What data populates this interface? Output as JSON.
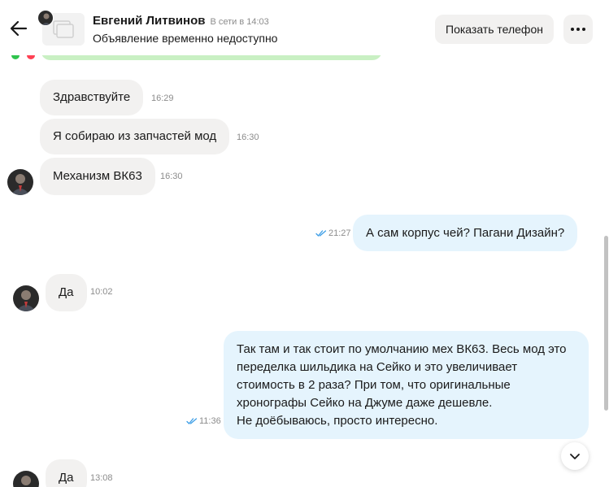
{
  "header": {
    "contact_name": "Евгений Литвинов",
    "presence": "В сети в 14:03",
    "listing_status": "Объявление временно недоступно",
    "show_phone_label": "Показать телефон"
  },
  "messages": [
    {
      "dir": "in",
      "text": "Здравствуйте",
      "time": "16:29"
    },
    {
      "dir": "in",
      "text": "Я собираю из запчастей мод",
      "time": "16:30"
    },
    {
      "dir": "in",
      "text": "Механизм ВК63",
      "time": "16:30"
    },
    {
      "dir": "out",
      "text": "А сам корпус чей? Пагани Дизайн?",
      "time": "21:27"
    },
    {
      "dir": "in",
      "text": "Да",
      "time": "10:02"
    },
    {
      "dir": "out",
      "lines": [
        "Так там и так стоит по умолчанию мех ВК63. Весь мод это",
        "переделка шильдика на Сейко и это увеличивает",
        "стоимость в 2 раза? При том, что оригинальные",
        "хронографы Сейко на Джуме даже дешевле.",
        "Не доёбываюсь, просто интересно."
      ],
      "time": "11:36"
    },
    {
      "dir": "in",
      "text": "Да",
      "time": "13:08"
    }
  ],
  "colors": {
    "incoming_bubble": "#f2f1f0",
    "outgoing_bubble": "#e5f4fd",
    "read_ticks": "#3d9ee6"
  },
  "icons": [
    "arrow-left-icon",
    "more-dots-icon",
    "double-check-icon",
    "chevron-down-icon",
    "listing-placeholder-icon"
  ]
}
